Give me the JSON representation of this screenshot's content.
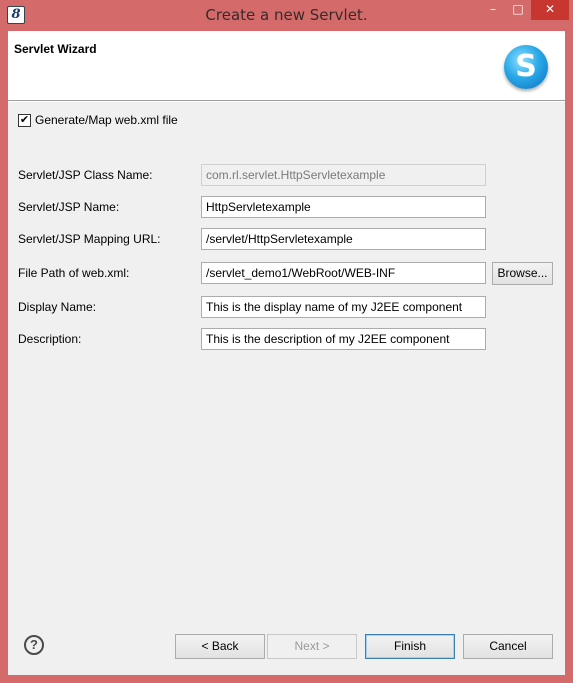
{
  "window": {
    "title": "Create a new Servlet.",
    "app_icon_glyph": "8",
    "controls": {
      "minimize": "–",
      "maximize": "□",
      "close": "✕"
    }
  },
  "header": {
    "title": "Servlet Wizard",
    "logo_glyph": "S",
    "logo_icon": "myeclipse-logo-icon"
  },
  "generate": {
    "checked": true,
    "check_glyph": "✔",
    "label": "Generate/Map web.xml file"
  },
  "fields": {
    "class_name": {
      "label": "Servlet/JSP Class Name:",
      "value": "com.rl.servlet.HttpServletexample",
      "enabled": false
    },
    "name": {
      "label": "Servlet/JSP Name:",
      "value": "HttpServletexample"
    },
    "mapping_url": {
      "label": "Servlet/JSP Mapping URL:",
      "value": "/servlet/HttpServletexample"
    },
    "file_path": {
      "label": "File Path of web.xml:",
      "value": "/servlet_demo1/WebRoot/WEB-INF",
      "browse_label": "Browse..."
    },
    "display_name": {
      "label": "Display Name:",
      "value": "This is the display name of my J2EE component"
    },
    "description": {
      "label": "Description:",
      "value": "This is the description of my J2EE component"
    }
  },
  "footer": {
    "help_glyph": "?",
    "back_label": "< Back",
    "next_label": "Next >",
    "finish_label": "Finish",
    "cancel_label": "Cancel"
  },
  "colors": {
    "window_frame": "#d46a6a",
    "close_button": "#c7372f",
    "dialog_bg": "#f0f0f0"
  }
}
